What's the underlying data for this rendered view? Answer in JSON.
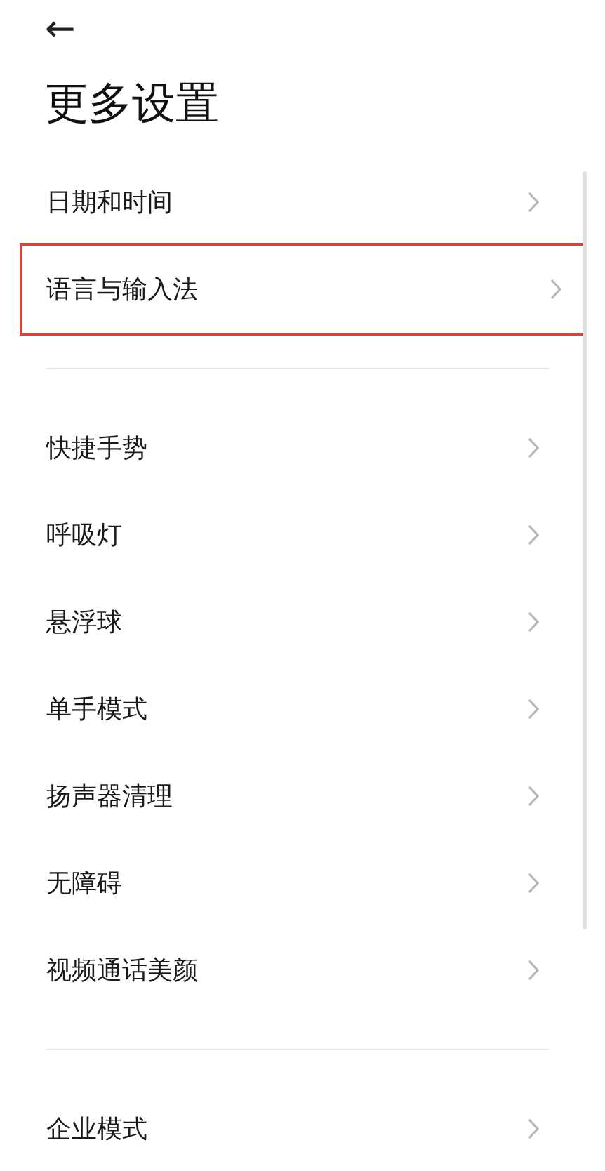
{
  "header": {
    "back": "←",
    "title": "更多设置"
  },
  "sections": [
    {
      "items": [
        {
          "label": "日期和时间",
          "highlighted": false
        },
        {
          "label": "语言与输入法",
          "highlighted": true
        }
      ]
    },
    {
      "items": [
        {
          "label": "快捷手势",
          "highlighted": false
        },
        {
          "label": "呼吸灯",
          "highlighted": false
        },
        {
          "label": "悬浮球",
          "highlighted": false
        },
        {
          "label": "单手模式",
          "highlighted": false
        },
        {
          "label": "扬声器清理",
          "highlighted": false
        },
        {
          "label": "无障碍",
          "highlighted": false
        },
        {
          "label": "视频通话美颜",
          "highlighted": false
        }
      ]
    },
    {
      "items": [
        {
          "label": "企业模式",
          "highlighted": false
        }
      ]
    }
  ]
}
